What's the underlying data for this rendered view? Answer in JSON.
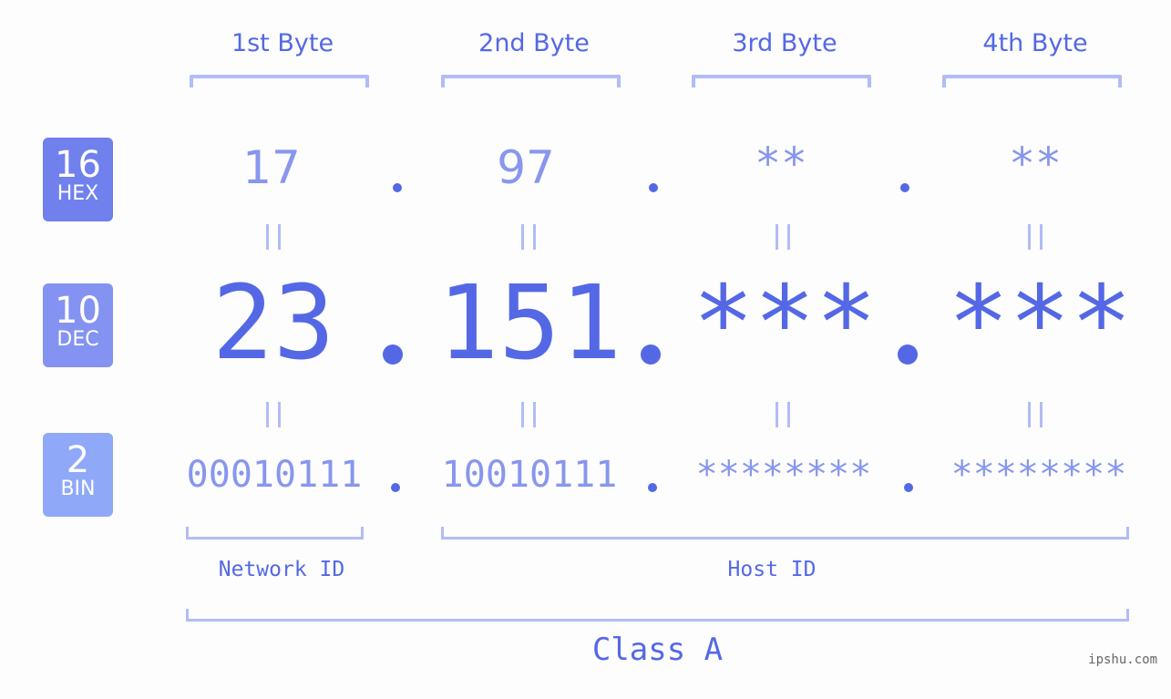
{
  "byte_headers": [
    "1st Byte",
    "2nd Byte",
    "3rd Byte",
    "4th Byte"
  ],
  "badges": {
    "hex": {
      "num": "16",
      "label": "HEX",
      "color": "#7080ec"
    },
    "dec": {
      "num": "10",
      "label": "DEC",
      "color": "#8493f1"
    },
    "bin": {
      "num": "2",
      "label": "BIN",
      "color": "#90a8f8"
    }
  },
  "hex": [
    "17",
    "97",
    "**",
    "**"
  ],
  "dec": [
    "23",
    "151",
    "***",
    "***"
  ],
  "bin": [
    "00010111",
    "10010111",
    "********",
    "********"
  ],
  "separator": ".",
  "network_id_label": "Network ID",
  "host_id_label": "Host ID",
  "class_label": "Class A",
  "watermark": "ipshu.com",
  "colors": {
    "primary": "#5468e6",
    "light_value": "#8796ee",
    "bracket": "#b2bcf7"
  }
}
